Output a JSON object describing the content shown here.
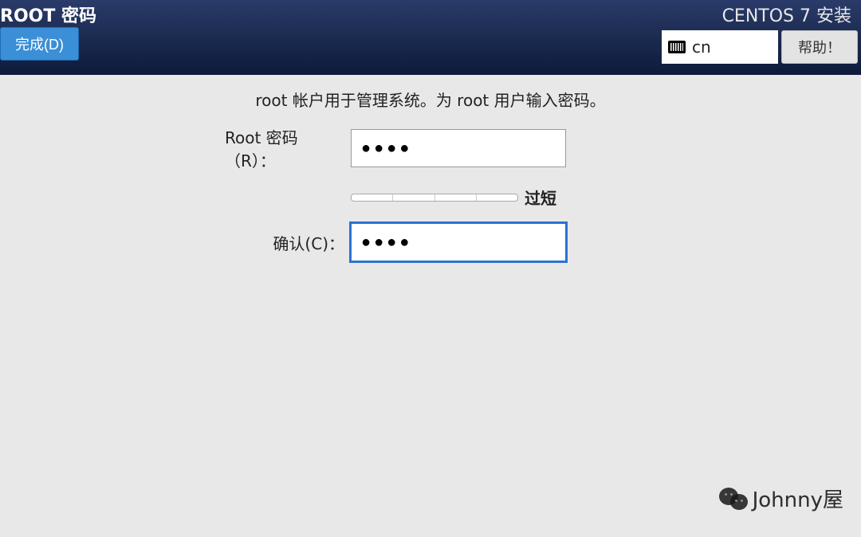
{
  "header": {
    "title": "ROOT 密码",
    "subtitle": "CENTOS 7 安装",
    "done_label": "完成(D)",
    "keyboard_layout": "cn",
    "help_label": "帮助！"
  },
  "form": {
    "instruction": "root 帐户用于管理系统。为 root 用户输入密码。",
    "password_label": "Root 密码（R）：",
    "password_value": "●●●●",
    "confirm_label": "确认(C)：",
    "confirm_value": "●●●●",
    "strength_label": "过短"
  },
  "watermark": {
    "text": "Johnny屋"
  }
}
